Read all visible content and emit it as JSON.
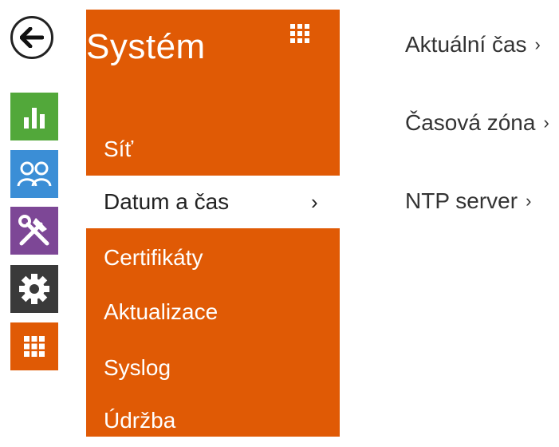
{
  "rail": {
    "back_icon": "arrow-left-icon",
    "tiles": [
      {
        "icon": "bar-chart-icon",
        "color": "#52a83a"
      },
      {
        "icon": "users-icon",
        "color": "#3b8ed6"
      },
      {
        "icon": "tools-icon",
        "color": "#7d4796"
      },
      {
        "icon": "gear-icon",
        "color": "#3a3a3a"
      },
      {
        "icon": "grid-icon",
        "color": "#e05a05"
      }
    ]
  },
  "panel": {
    "title": "Systém",
    "accent": "#e05a05",
    "items": [
      {
        "label": "Síť"
      },
      {
        "label": "Datum a čas",
        "active": true
      },
      {
        "label": "Certifikáty"
      },
      {
        "label": "Aktualizace"
      },
      {
        "label": "Syslog"
      },
      {
        "label": "Údržba"
      }
    ],
    "chevron": "›"
  },
  "subitems": [
    {
      "label": "Aktuální čas"
    },
    {
      "label": "Časová zóna"
    },
    {
      "label": "NTP server"
    }
  ]
}
